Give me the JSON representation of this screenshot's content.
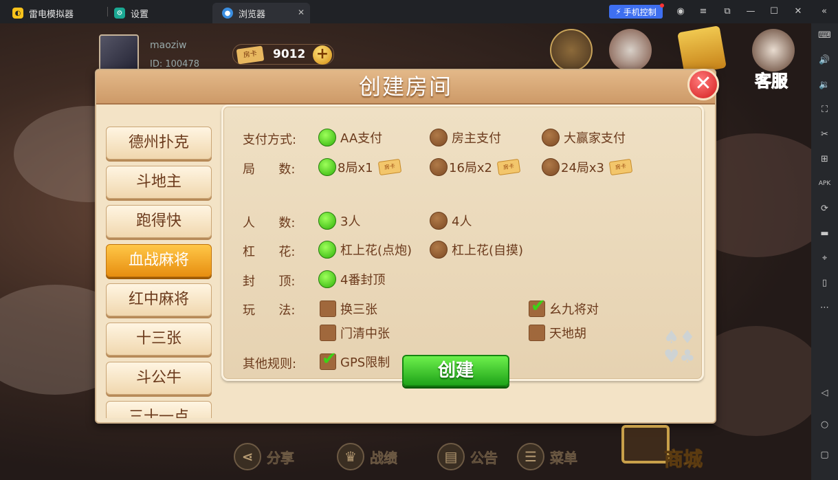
{
  "titlebar": {
    "app_name": "雷电模拟器",
    "settings_tab": "设置",
    "browser_tab": "浏览器",
    "phone_control": "手机控制"
  },
  "user": {
    "name": "maoziw",
    "id": "ID: 100478",
    "room_card_label": "房卡",
    "room_card_count": "9012"
  },
  "top_icons": {
    "service_label": "客服"
  },
  "dialog": {
    "title": "创建房间",
    "games": [
      {
        "label": "德州扑克",
        "selected": false
      },
      {
        "label": "斗地主",
        "selected": false
      },
      {
        "label": "跑得快",
        "selected": false
      },
      {
        "label": "血战麻将",
        "selected": true
      },
      {
        "label": "红中麻将",
        "selected": false
      },
      {
        "label": "十三张",
        "selected": false
      },
      {
        "label": "斗公牛",
        "selected": false
      },
      {
        "label": "三十一点",
        "selected": false
      }
    ],
    "settings": {
      "pay_label": "支付方式:",
      "pay_options": [
        "AA支付",
        "房主支付",
        "大赢家支付"
      ],
      "rounds_label": "局      数:",
      "round_options": [
        "8局x1",
        "16局x2",
        "24局x3"
      ],
      "ticket_label": "房卡",
      "players_label": "人      数:",
      "player_options": [
        "3人",
        "4人"
      ],
      "gang_label": "杠      花:",
      "gang_options": [
        "杠上花(点炮)",
        "杠上花(自摸)"
      ],
      "cap_label": "封      顶:",
      "cap_options": [
        "4番封顶"
      ],
      "play_label": "玩      法:",
      "play_options": [
        "换三张",
        "幺九将对",
        "门清中张",
        "天地胡"
      ],
      "other_label": "其他规则:",
      "other_options": [
        "GPS限制"
      ]
    },
    "create_button": "创建"
  },
  "bottom": {
    "share": "分享",
    "record": "战绩",
    "notice": "公告",
    "menu": "菜单",
    "shop": "商城"
  },
  "icons": {
    "close": "close-icon",
    "plus": "plus-icon",
    "share": "share-icon",
    "trophy": "trophy-icon",
    "notice": "notice-icon",
    "menu": "menu-icon"
  },
  "colors": {
    "selected_radio": "#3cd317",
    "unselected_radio": "#8a5430",
    "selected_game": "#f0a020",
    "create_button": "#2fc41f",
    "panel": "#ecdcbf"
  }
}
